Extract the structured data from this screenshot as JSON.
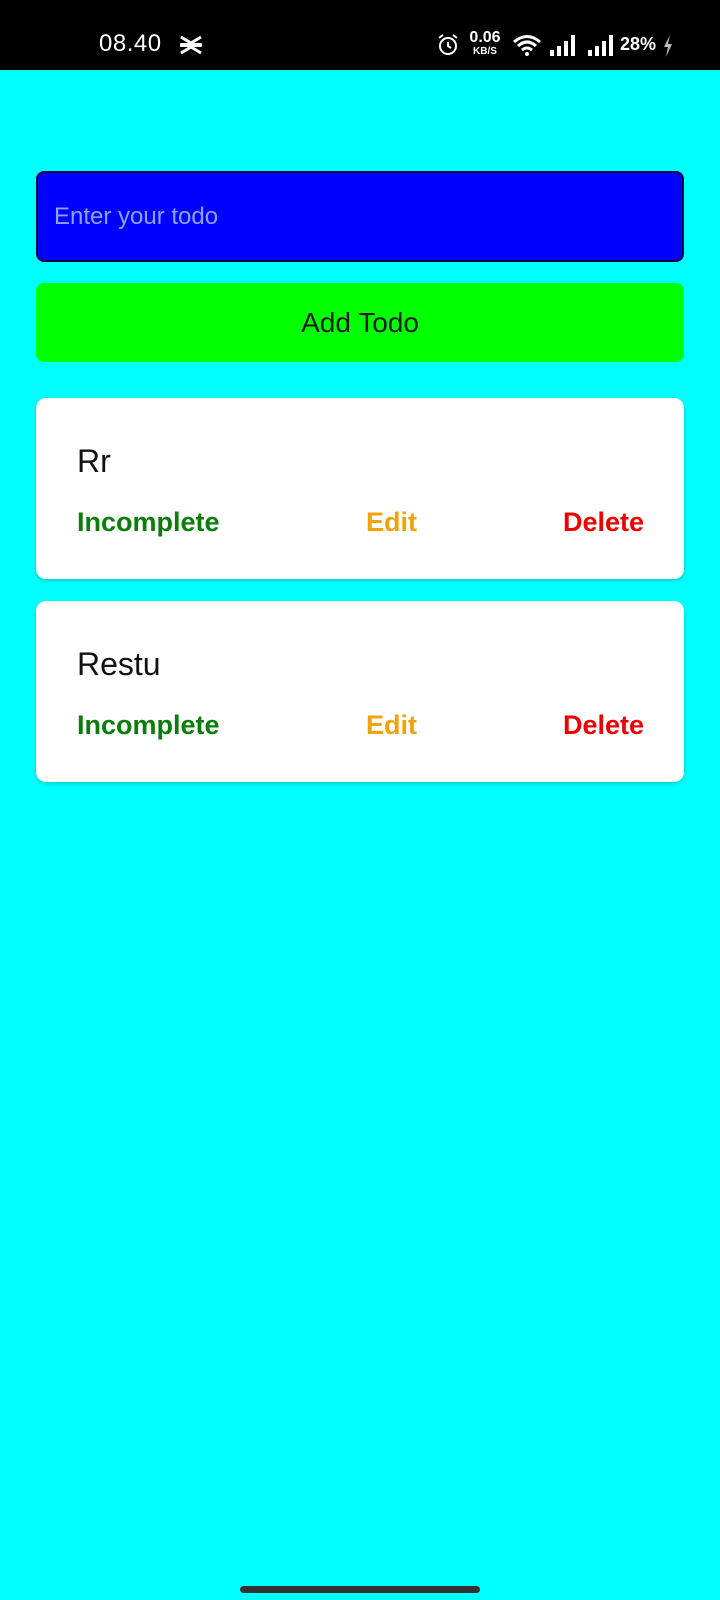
{
  "status_bar": {
    "time": "08.40",
    "net_speed_value": "0.06",
    "net_speed_unit": "KB/S",
    "battery": "28%",
    "icons": [
      "capcut-icon",
      "alarm-icon",
      "wifi-icon",
      "signal-icon",
      "signal-icon",
      "charging-icon"
    ]
  },
  "input": {
    "placeholder": "Enter your todo",
    "value": ""
  },
  "add_button": {
    "label": "Add Todo"
  },
  "todos": [
    {
      "title": "Rr",
      "status": "Incomplete",
      "edit": "Edit",
      "delete": "Delete"
    },
    {
      "title": "Restu",
      "status": "Incomplete",
      "edit": "Edit",
      "delete": "Delete"
    }
  ],
  "colors": {
    "background": "#00ffff",
    "input_background": "#0000ff",
    "add_button": "#00ff00",
    "status_text": "#0a7d0a",
    "edit_text": "#f2a20c",
    "delete_text": "#ee0000"
  }
}
